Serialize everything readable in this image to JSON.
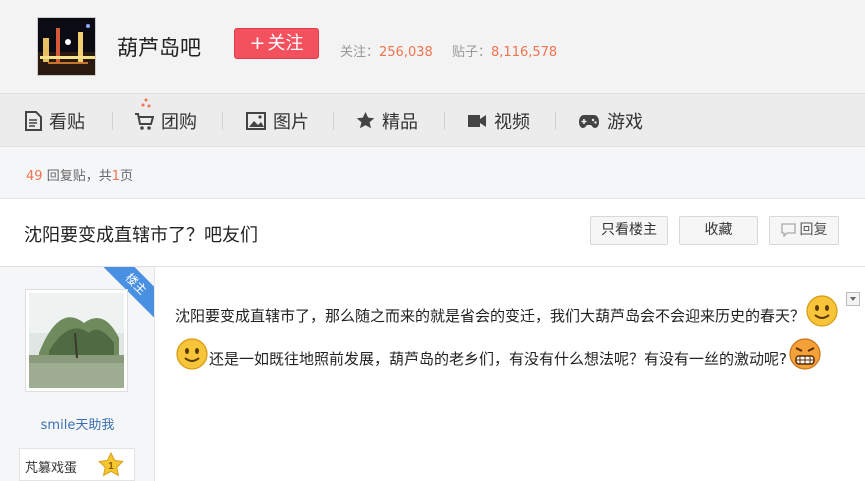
{
  "header": {
    "forum_name": "葫芦岛吧",
    "follow_label": "关注",
    "follow_plus": "+",
    "stats": {
      "follow_label": "关注：",
      "follow_count": "256,038",
      "posts_label": "贴子：",
      "posts_count": "8,116,578"
    }
  },
  "nav": {
    "items": [
      {
        "label": "看贴",
        "icon": "document-icon"
      },
      {
        "label": "团购",
        "icon": "cart-icon"
      },
      {
        "label": "图片",
        "icon": "image-icon"
      },
      {
        "label": "精品",
        "icon": "star-icon"
      },
      {
        "label": "视频",
        "icon": "video-icon"
      },
      {
        "label": "游戏",
        "icon": "gamepad-icon"
      }
    ]
  },
  "count_bar": {
    "reply_count": "49",
    "reply_label": "回复贴，共",
    "page_count": "1",
    "page_label": "页"
  },
  "thread": {
    "title": "沈阳要变成直辖市了？吧友们",
    "buttons": {
      "only_op": "只看楼主",
      "favorite": "收藏",
      "reply": "回复"
    }
  },
  "post": {
    "ribbon": "楼主",
    "author": "smile天助我",
    "badge": "芃篡戏蛋",
    "level": "1",
    "text_part1": "沈阳要变成直辖市了，那么随之而来的就是省会的变迁，我们大葫芦岛会不会迎来历史的春天？",
    "text_part2": "还是一如既往地照前发展，葫芦岛的老乡们，有没有什么想法呢？有没有一丝的激动呢?",
    "emojis": [
      "smile-emoji",
      "smile-emoji",
      "grimace-emoji"
    ]
  },
  "colors": {
    "accent_red": "#f4515f",
    "number_orange": "#f2734f",
    "link_blue": "#3a6fb5",
    "ribbon_blue": "#4a90e2"
  }
}
